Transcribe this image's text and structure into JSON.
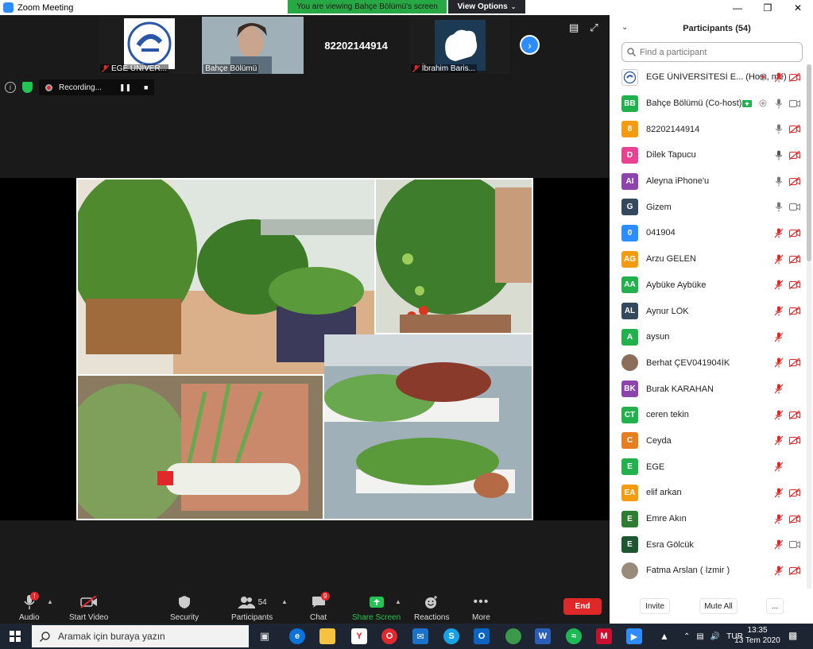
{
  "window": {
    "title": "Zoom Meeting",
    "share_banner": "You are viewing Bahçe Bölümü's screen",
    "view_options": "View Options"
  },
  "thumbnails": [
    {
      "name": "EGE ÜNİVER..."
    },
    {
      "name": "Bahçe Bölümü"
    },
    {
      "number": "82202144914"
    },
    {
      "name": "İbrahim Baris..."
    }
  ],
  "recording": {
    "label": "Recording..."
  },
  "toolbar": {
    "audio": "Audio",
    "audio_badge": "!",
    "start_video": "Start Video",
    "security": "Security",
    "participants": "Participants",
    "participants_count": "54",
    "chat": "Chat",
    "chat_badge": "9",
    "share_screen": "Share Screen",
    "reactions": "Reactions",
    "more": "More",
    "end": "End"
  },
  "panel": {
    "title": "Participants (54)",
    "search_placeholder": "Find a participant",
    "invite": "Invite",
    "mute_all": "Mute All",
    "more": "..."
  },
  "participants": [
    {
      "initials": "",
      "name": "EGE ÜNİVERSİTESİ E...  (Host, me)",
      "color": "#ffffff",
      "mic": "muted",
      "video": "off",
      "extra": "record"
    },
    {
      "initials": "BB",
      "name": "Bahçe Bölümü (Co-host)",
      "color": "#23b14d",
      "mic": "on",
      "video": "on",
      "extra": "share"
    },
    {
      "initials": "8",
      "name": "82202144914",
      "color": "#f39c12",
      "mic": "on",
      "video": "off"
    },
    {
      "initials": "D",
      "name": "Dilek Tapucu",
      "color": "#e84393",
      "mic": "active",
      "video": "off"
    },
    {
      "initials": "AI",
      "name": "Aleyna iPhone'u",
      "color": "#8e44ad",
      "mic": "on",
      "video": "off"
    },
    {
      "initials": "G",
      "name": "Gizem",
      "color": "#34495e",
      "mic": "on",
      "video": "on"
    },
    {
      "initials": "0",
      "name": "041904",
      "color": "#2d8cff",
      "mic": "muted",
      "video": "off"
    },
    {
      "initials": "AG",
      "name": "Arzu GELEN",
      "color": "#f39c12",
      "mic": "muted",
      "video": "off"
    },
    {
      "initials": "AA",
      "name": "Aybüke Aybüke",
      "color": "#23b14d",
      "mic": "muted",
      "video": "off"
    },
    {
      "initials": "AL",
      "name": "Aynur LÖK",
      "color": "#34495e",
      "mic": "muted",
      "video": "off"
    },
    {
      "initials": "A",
      "name": "aysun",
      "color": "#23b14d",
      "mic": "muted",
      "video": "none"
    },
    {
      "initials": "",
      "name": "Berhat ÇEV041904İK",
      "color": "#8a6d5a",
      "mic": "muted",
      "video": "off"
    },
    {
      "initials": "BK",
      "name": "Burak KARAHAN",
      "color": "#8e44ad",
      "mic": "muted",
      "video": "none"
    },
    {
      "initials": "CT",
      "name": "ceren tekin",
      "color": "#23b14d",
      "mic": "muted",
      "video": "off"
    },
    {
      "initials": "C",
      "name": "Ceyda",
      "color": "#e67e22",
      "mic": "muted",
      "video": "off"
    },
    {
      "initials": "E",
      "name": "EGE",
      "color": "#23b14d",
      "mic": "muted",
      "video": "none"
    },
    {
      "initials": "EA",
      "name": "elif arkan",
      "color": "#f39c12",
      "mic": "muted",
      "video": "off"
    },
    {
      "initials": "E",
      "name": "Emre Akın",
      "color": "#2e7d32",
      "mic": "muted",
      "video": "off"
    },
    {
      "initials": "E",
      "name": "Esra Gölcük",
      "color": "#1e5631",
      "mic": "muted",
      "video": "on"
    },
    {
      "initials": "",
      "name": "Fatma Arslan ( İzmir )",
      "color": "#9a8a7a",
      "mic": "muted",
      "video": "off"
    }
  ],
  "taskbar": {
    "search_placeholder": "Aramak için buraya yazın",
    "lang": "TUR",
    "time": "13:35",
    "date": "13 Tem 2020"
  }
}
